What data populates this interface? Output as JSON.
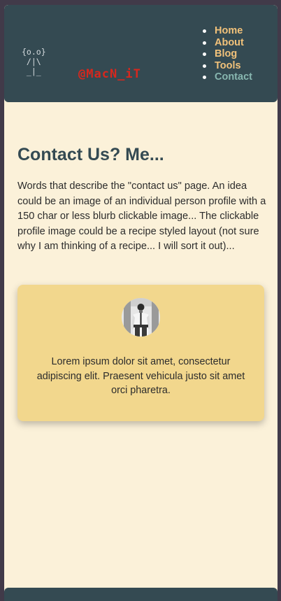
{
  "header": {
    "logo_art": "{o.o}\n /|\\\n _|_",
    "brand": "@MacN_iT"
  },
  "nav": {
    "items": [
      {
        "label": "Home"
      },
      {
        "label": "About"
      },
      {
        "label": "Blog"
      },
      {
        "label": "Tools"
      },
      {
        "label": "Contact",
        "active": true
      }
    ]
  },
  "main": {
    "title": "Contact Us? Me...",
    "intro": "Words that describe the \"contact us\" page. An idea could be an image of an individual person profile with a 150 char or less blurb clickable image... The clickable profile image could be a recipe styled layout (not sure why I am thinking of a recipe... I will sort it out)...",
    "card": {
      "text": "Lorem ipsum dolor sit amet, consectetur adipiscing elit. Praesent vehicula justo sit amet orci pharetra."
    }
  },
  "colors": {
    "page_bg": "#fbf1d9",
    "header_bg": "#344a52",
    "nav_link": "#f2c27a",
    "nav_active": "#88b7b0",
    "brand": "#d8271d",
    "card_bg": "#f2d78d"
  }
}
